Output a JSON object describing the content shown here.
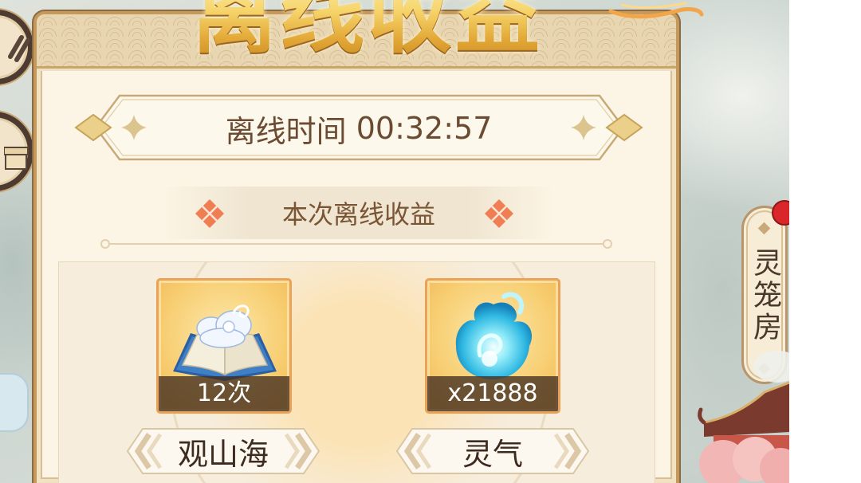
{
  "dialog": {
    "title": "离线收益"
  },
  "offline_time": {
    "label": "离线时间",
    "value": "00:32:57"
  },
  "rewards_section": {
    "title": "本次离线收益"
  },
  "rewards": [
    {
      "name": "观山海",
      "count": "12次",
      "icon": "book-icon"
    },
    {
      "name": "灵气",
      "count": "x21888",
      "icon": "spirit-flame-icon"
    }
  ],
  "side_tab": {
    "label": "灵笼房",
    "notification": true
  },
  "left_buttons": [
    {
      "icon": "scroll-lines-icon"
    },
    {
      "icon": "gift-box-icon"
    }
  ],
  "colors": {
    "title_gold": "#f0c14b",
    "text_brown": "#6b4b31",
    "panel_cream": "#fcf4e4",
    "frame_gold": "#c49a5c",
    "accent_orange": "#ef7f52",
    "card_border": "#e9a256",
    "notification_red": "#d8262b"
  }
}
